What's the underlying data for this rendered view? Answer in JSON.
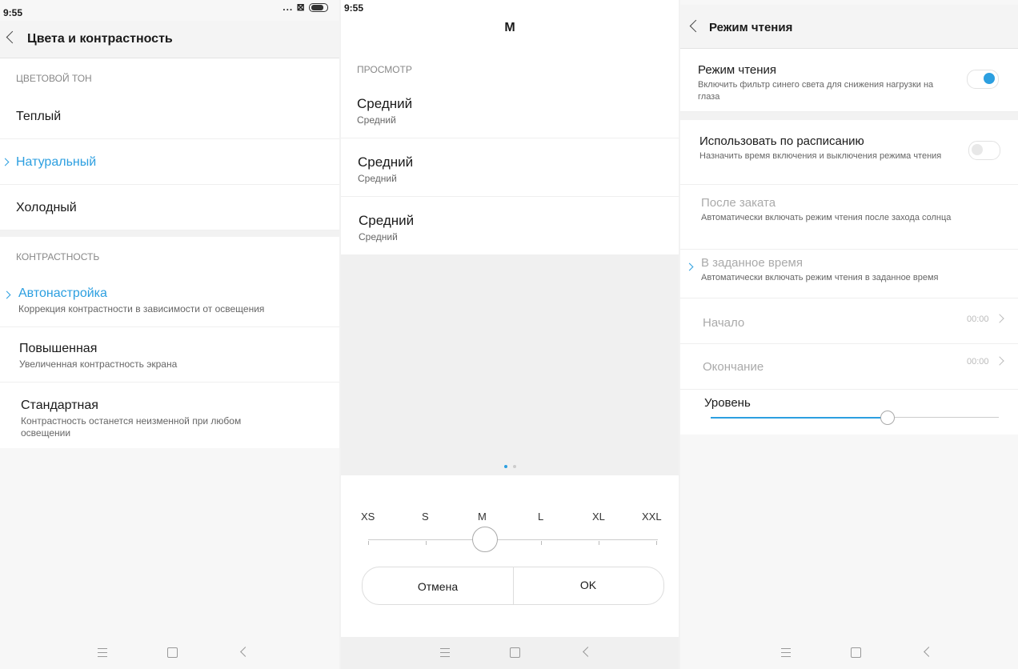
{
  "panel1": {
    "status_time": "9:55",
    "status_icons": "... ⊠",
    "title": "Цвета и контрастность",
    "tone_section": "ЦВЕТОВОЙ ТОН",
    "tones": [
      "Теплый",
      "Натуральный",
      "Холодный"
    ],
    "contrast_section": "КОНТРАСТНОСТЬ",
    "contrast": [
      {
        "title": "Автонастройка",
        "subtitle": "Коррекция контрастности в зависимости от освещения"
      },
      {
        "title": "Повышенная",
        "subtitle": "Увеличенная контрастность экрана"
      },
      {
        "title": "Стандартная",
        "subtitle": "Контрастность останется неизменной при любом освещении"
      }
    ]
  },
  "panel2": {
    "status_time": "9:55",
    "title": "M",
    "preview_section": "ПРОСМОТР",
    "previews": [
      {
        "title": "Средний",
        "subtitle": "Средний"
      },
      {
        "title": "Средний",
        "subtitle": "Средний"
      },
      {
        "title": "Средний",
        "subtitle": "Средний"
      }
    ],
    "sizes": [
      "XS",
      "S",
      "M",
      "L",
      "XL",
      "XXL"
    ],
    "selected_size": "M",
    "cancel_label": "Отмена",
    "ok_label": "OK"
  },
  "panel3": {
    "title": "Режим чтения",
    "reading_mode": {
      "title": "Режим чтения",
      "subtitle": "Включить фильтр синего света для снижения нагрузки на глаза",
      "enabled": true
    },
    "schedule": {
      "title": "Использовать по расписанию",
      "subtitle": "Назначить время включения и выключения режима чтения",
      "enabled": false
    },
    "sunset": {
      "title": "После заката",
      "subtitle": "Автоматически включать режим чтения после захода солнца"
    },
    "custom_time": {
      "title": "В заданное время",
      "subtitle": "Автоматически включать режим чтения в заданное время"
    },
    "start": {
      "label": "Начало",
      "value": "00:00"
    },
    "end": {
      "label": "Окончание",
      "value": "00:00"
    },
    "level_label": "Уровень",
    "level": 0.61
  },
  "colors": {
    "accent": "#2c9fe0"
  }
}
